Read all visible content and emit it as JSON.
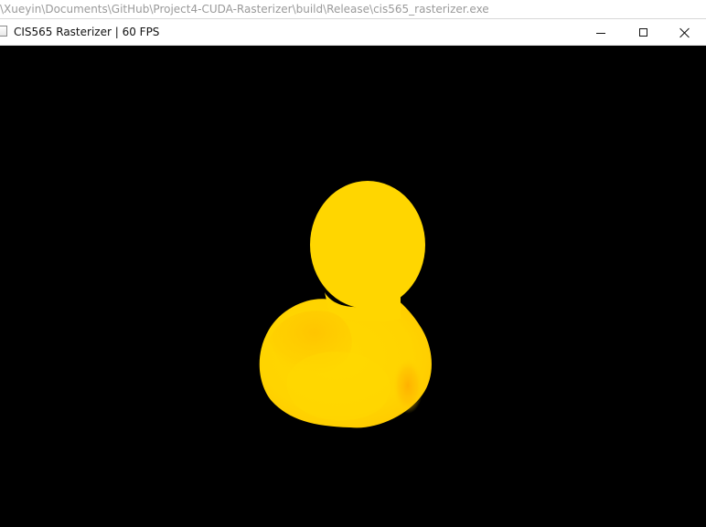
{
  "background_window": {
    "path": "\\Xueyin\\Documents\\GitHub\\Project4-CUDA-Rasterizer\\build\\Release\\cis565_rasterizer.exe"
  },
  "window": {
    "title": "CIS565 Rasterizer | 60 FPS",
    "icon": "application-icon"
  },
  "controls": {
    "minimize": "minimize-icon",
    "maximize": "maximize-icon",
    "close": "close-icon"
  },
  "scene": {
    "object": "rubber duck",
    "colors": {
      "background": "#000000",
      "duck_primary": "#ffd600",
      "duck_shade": "#ffc400",
      "duck_orange": "#ffad00"
    }
  }
}
